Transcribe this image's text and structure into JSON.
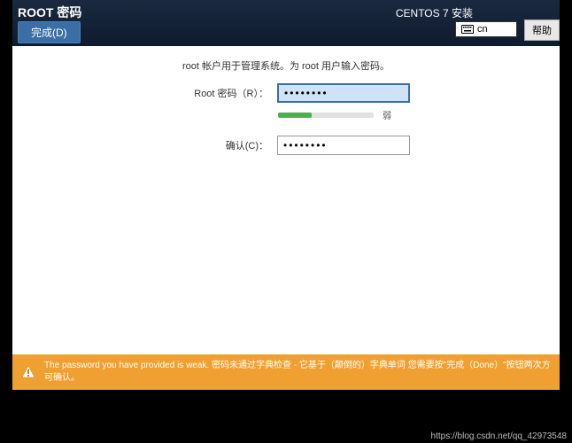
{
  "header": {
    "title": "ROOT 密码",
    "done_label": "完成(D)",
    "installer_label": "CENTOS 7 安装",
    "lang_code": "cn",
    "help_label": "帮助"
  },
  "content": {
    "description": "root 帐户用于管理系统。为 root 用户输入密码。",
    "password_label": "Root 密码（R）：",
    "password_value": "••••••••",
    "confirm_label": "确认(C)：",
    "confirm_value": "••••••••",
    "strength_label": "弱"
  },
  "warning": {
    "text": "The password you have provided is weak. 密码未通过字典检查 - 它基于（颠倒的）字典单词 您需要按\"完成（Done）\"按钮两次方可确认。"
  },
  "watermark": "https://blog.csdn.net/qq_42973548"
}
